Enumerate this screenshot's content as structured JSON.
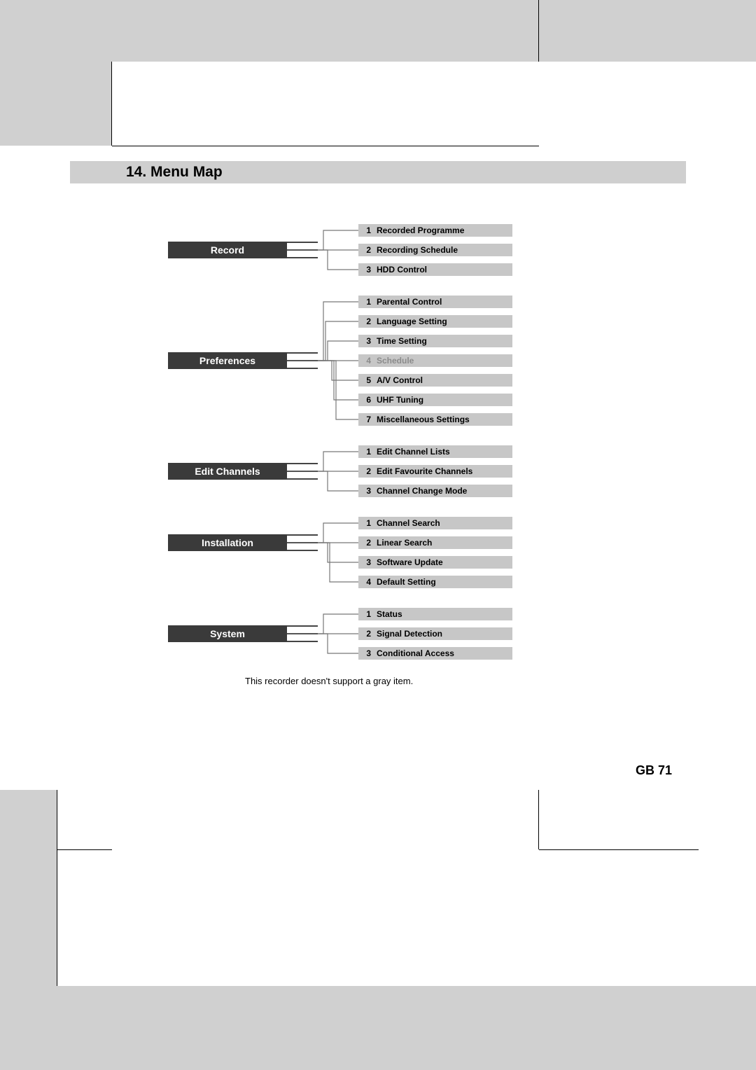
{
  "heading": "14. Menu Map",
  "footnote": "This recorder doesn't support a gray item.",
  "page_number": "GB 71",
  "menu": [
    {
      "title": "Record",
      "items": [
        {
          "n": "1",
          "label": "Recorded Programme",
          "gray": false
        },
        {
          "n": "2",
          "label": "Recording Schedule",
          "gray": false
        },
        {
          "n": "3",
          "label": "HDD Control",
          "gray": false
        }
      ]
    },
    {
      "title": "Preferences",
      "items": [
        {
          "n": "1",
          "label": "Parental Control",
          "gray": false
        },
        {
          "n": "2",
          "label": "Language Setting",
          "gray": false
        },
        {
          "n": "3",
          "label": "Time Setting",
          "gray": false
        },
        {
          "n": "4",
          "label": "Schedule",
          "gray": true
        },
        {
          "n": "5",
          "label": "A/V Control",
          "gray": false
        },
        {
          "n": "6",
          "label": "UHF Tuning",
          "gray": false
        },
        {
          "n": "7",
          "label": "Miscellaneous Settings",
          "gray": false
        }
      ]
    },
    {
      "title": "Edit Channels",
      "items": [
        {
          "n": "1",
          "label": "Edit Channel Lists",
          "gray": false
        },
        {
          "n": "2",
          "label": "Edit Favourite Channels",
          "gray": false
        },
        {
          "n": "3",
          "label": "Channel Change Mode",
          "gray": false
        }
      ]
    },
    {
      "title": "Installation",
      "items": [
        {
          "n": "1",
          "label": "Channel Search",
          "gray": false
        },
        {
          "n": "2",
          "label": "Linear Search",
          "gray": false
        },
        {
          "n": "3",
          "label": "Software Update",
          "gray": false
        },
        {
          "n": "4",
          "label": "Default Setting",
          "gray": false
        }
      ]
    },
    {
      "title": "System",
      "items": [
        {
          "n": "1",
          "label": "Status",
          "gray": false
        },
        {
          "n": "2",
          "label": "Signal Detection",
          "gray": false
        },
        {
          "n": "3",
          "label": "Conditional Access",
          "gray": false
        }
      ]
    }
  ]
}
